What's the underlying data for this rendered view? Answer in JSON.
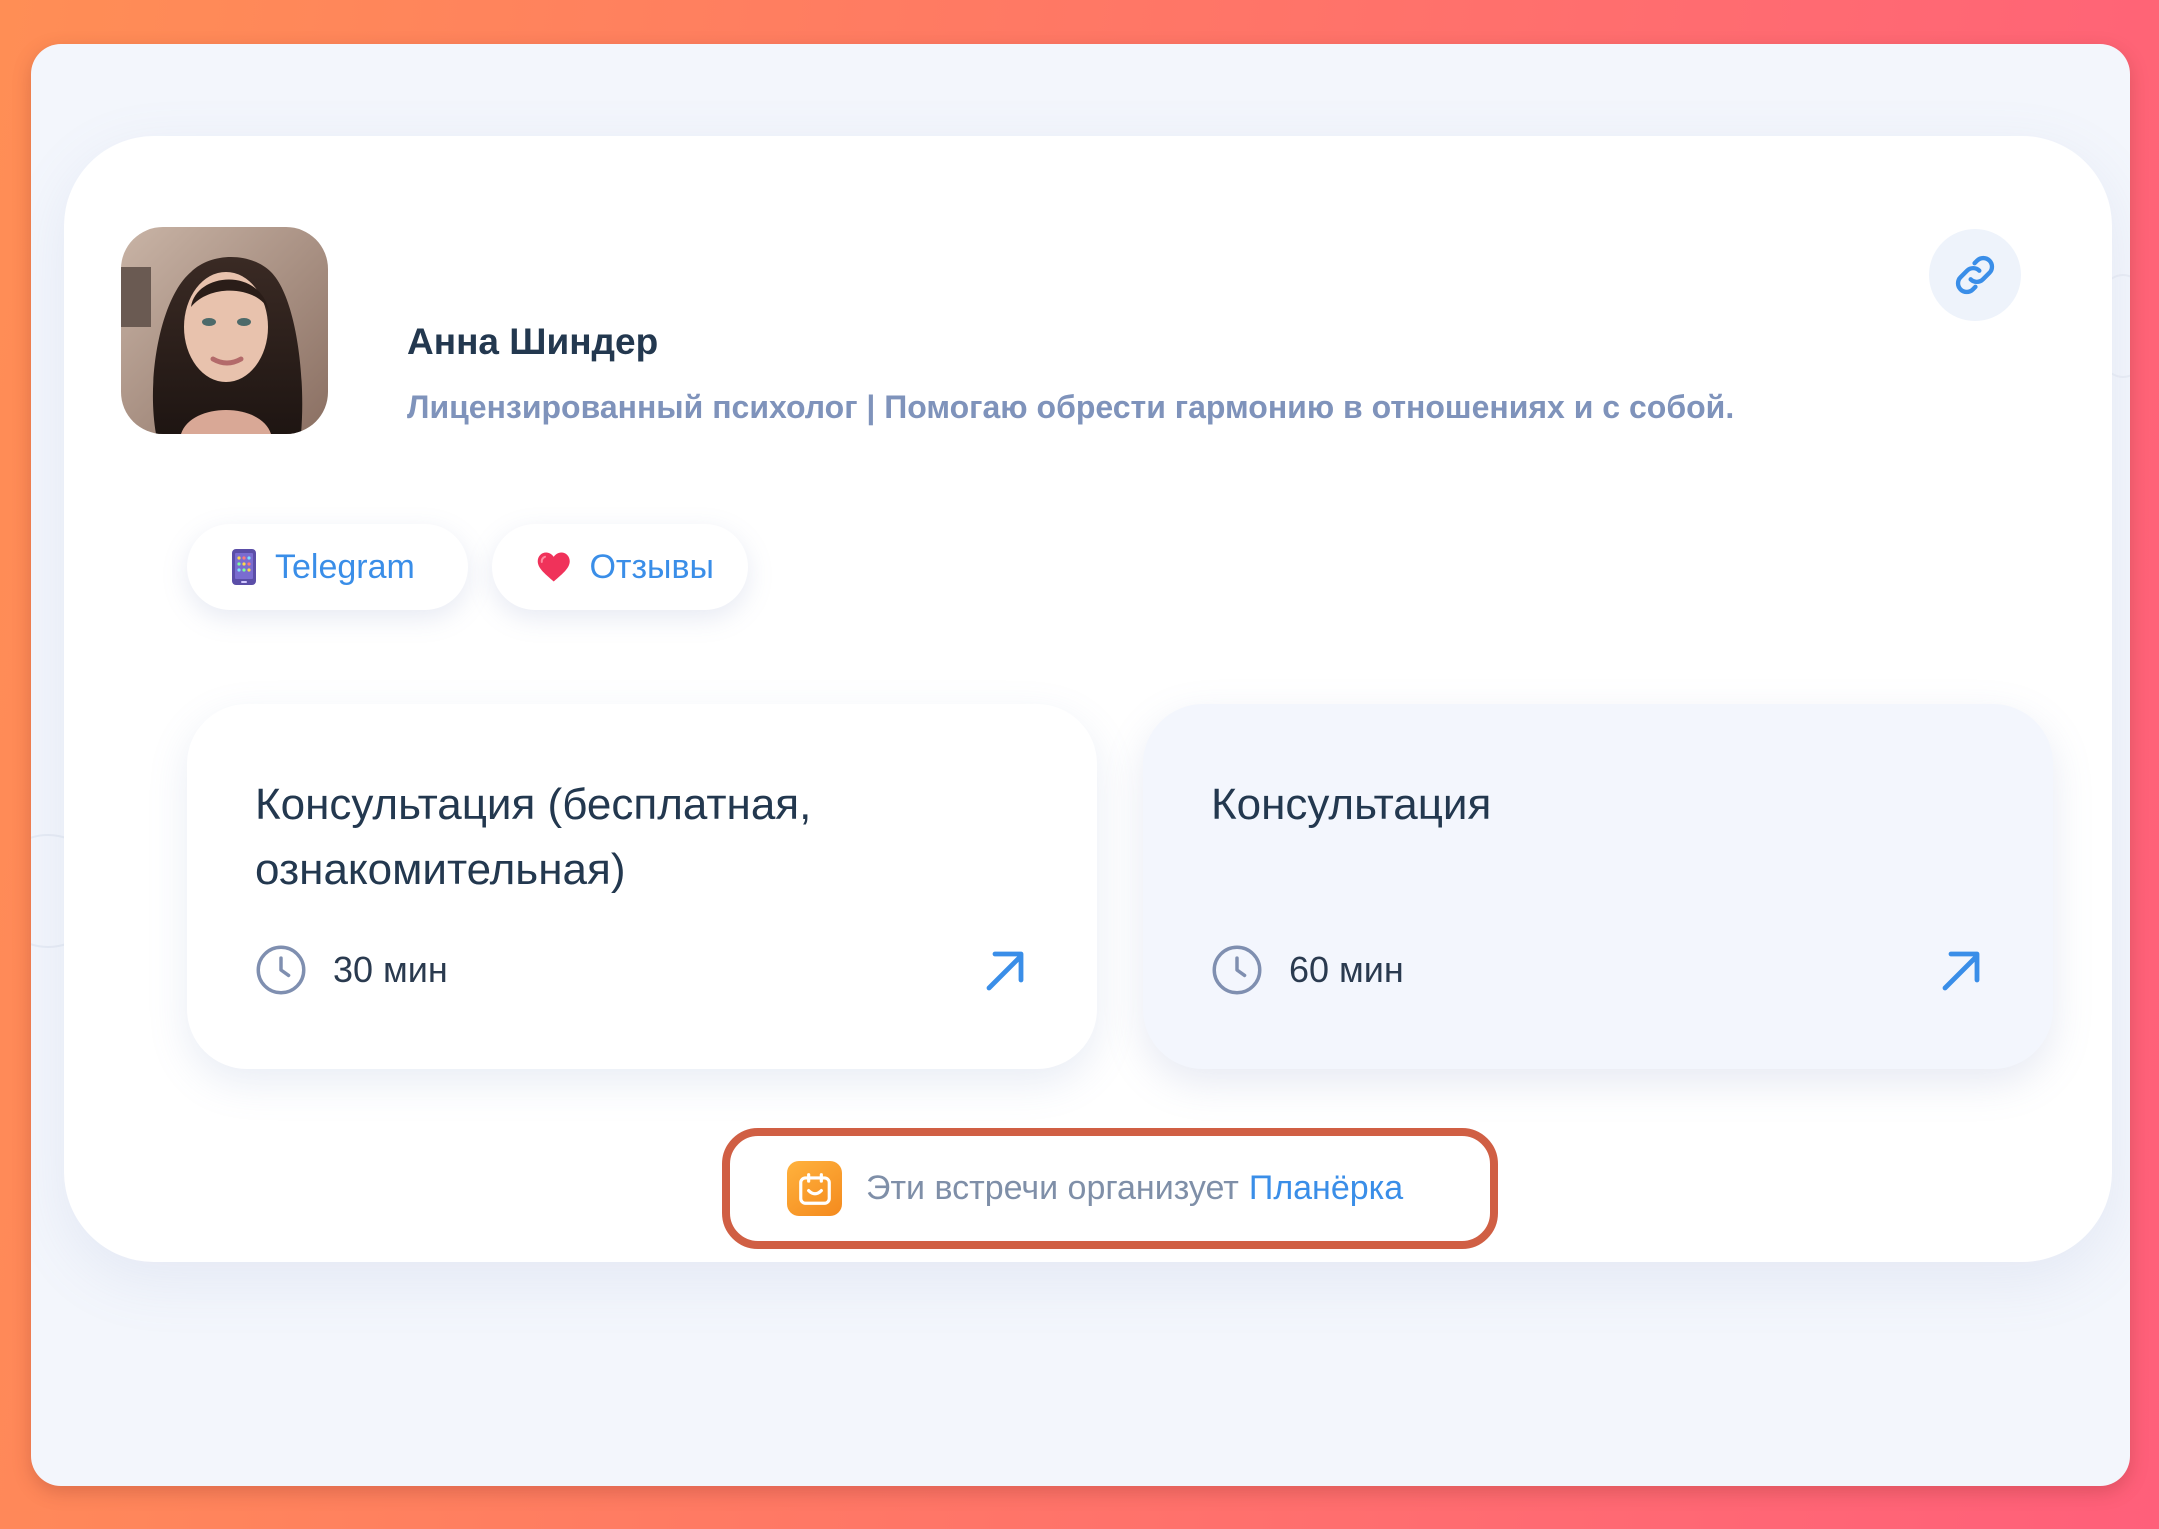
{
  "profile": {
    "name": "Анна Шиндер",
    "description": "Лицензированный психолог | Помогаю обрести гармонию в отношениях и с собой."
  },
  "links": [
    {
      "label": "Telegram",
      "icon": "phone-icon"
    },
    {
      "label": "Отзывы",
      "icon": "heart-icon"
    }
  ],
  "events": [
    {
      "title": "Консультация (бесплатная, ознакомительная)",
      "duration": "30 мин"
    },
    {
      "title": "Консультация",
      "duration": "60 мин"
    }
  ],
  "footer": {
    "text": "Эти встречи организует",
    "brand": "Планёрка"
  },
  "colors": {
    "accent": "#3a8ee8",
    "title": "#23384f",
    "muted": "#7f93bb",
    "highlight_border": "#d05f44",
    "logo": "#f7991f"
  }
}
